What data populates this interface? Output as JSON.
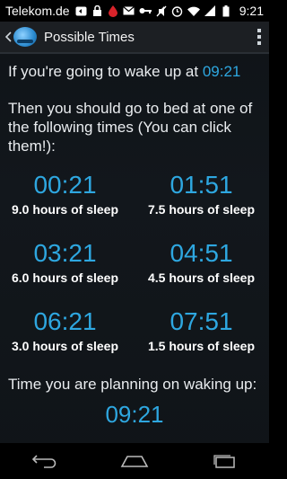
{
  "statusbar": {
    "carrier": "Telekom.de",
    "time": "9:21",
    "icons": [
      "notification-icon",
      "lock-icon",
      "drop-icon",
      "mail-icon",
      "key-icon",
      "mute-icon",
      "alarm-icon",
      "wifi-icon",
      "signal-icon",
      "battery-icon"
    ]
  },
  "actionbar": {
    "title": "Possible Times"
  },
  "main": {
    "wake_prefix": "If you're going to wake up at ",
    "wake_time": "09:21",
    "instruction": "Then you should go to bed at one of the following times (You can click them!):",
    "times": [
      {
        "time": "00:21",
        "hours": "9.0 hours of sleep"
      },
      {
        "time": "01:51",
        "hours": "7.5 hours of sleep"
      },
      {
        "time": "03:21",
        "hours": "6.0 hours of sleep"
      },
      {
        "time": "04:51",
        "hours": "4.5 hours of sleep"
      },
      {
        "time": "06:21",
        "hours": "3.0 hours of sleep"
      },
      {
        "time": "07:51",
        "hours": "1.5 hours of sleep"
      }
    ],
    "planning_label": "Time you are planning on waking up:",
    "planning_time": "09:21"
  },
  "colors": {
    "accent": "#2ea7e0",
    "background": "#12171c"
  }
}
